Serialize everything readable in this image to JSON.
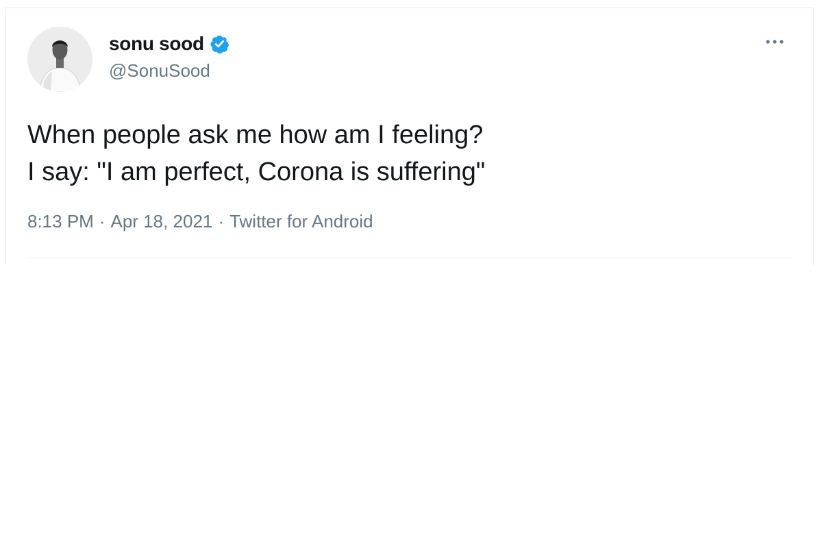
{
  "tweet": {
    "author": {
      "display_name": "sonu sood",
      "handle": "@SonuSood",
      "verified": true
    },
    "text": "When people ask me how am I feeling?\nI say: \"I am perfect, Corona is suffering\"",
    "time": "8:13 PM",
    "separator": "·",
    "date": "Apr 18, 2021",
    "source": "Twitter for Android",
    "icons": {
      "verified": "verified-badge-icon",
      "more": "more-options-icon"
    }
  },
  "colors": {
    "text_primary": "#14171a",
    "text_secondary": "#657786",
    "verified_blue": "#1da1f2",
    "border": "#e6ecf0"
  }
}
